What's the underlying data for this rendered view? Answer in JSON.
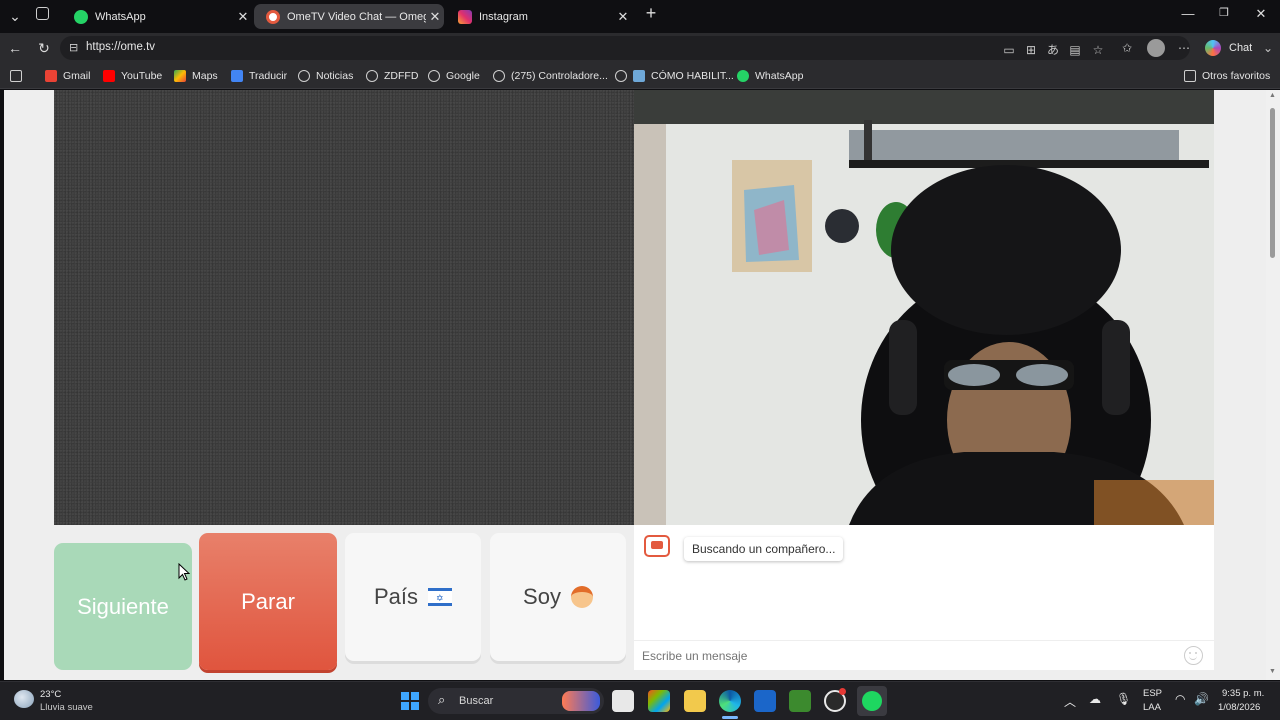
{
  "browser": {
    "tabs": [
      {
        "title": "WhatsApp",
        "active": false
      },
      {
        "title": "OmeTV Video Chat — Omegle",
        "active": true
      },
      {
        "title": "Instagram",
        "active": false
      }
    ],
    "url": "https://ome.tv",
    "chat_label": "Chat",
    "bookmarks": [
      "Gmail",
      "YouTube",
      "Maps",
      "Traducir",
      "Noticias",
      "ZDFFD",
      "Google",
      "(275) Controladore...",
      "CÓMO HABILIT...",
      "WhatsApp"
    ],
    "other_favorites": "Otros favoritos"
  },
  "page": {
    "buttons": {
      "next": "Siguiente",
      "stop": "Parar",
      "country": "País",
      "country_flag": "🇮🇱",
      "soy": "Soy",
      "soy_emoji": "👦"
    },
    "chat": {
      "status": "Buscando un compañero...",
      "placeholder": "Escribe un mensaje"
    }
  },
  "taskbar": {
    "weather_temp": "23°C",
    "weather_desc": "Lluvia suave",
    "search_label": "Buscar",
    "lang_top": "ESP",
    "lang_bottom": "LAA",
    "time": "9:35 p. m.",
    "date": "1/08/2026"
  },
  "colors": {
    "stop_button": "#e0553e",
    "next_button": "#a9d9b8",
    "brand": "#e35a3f"
  }
}
